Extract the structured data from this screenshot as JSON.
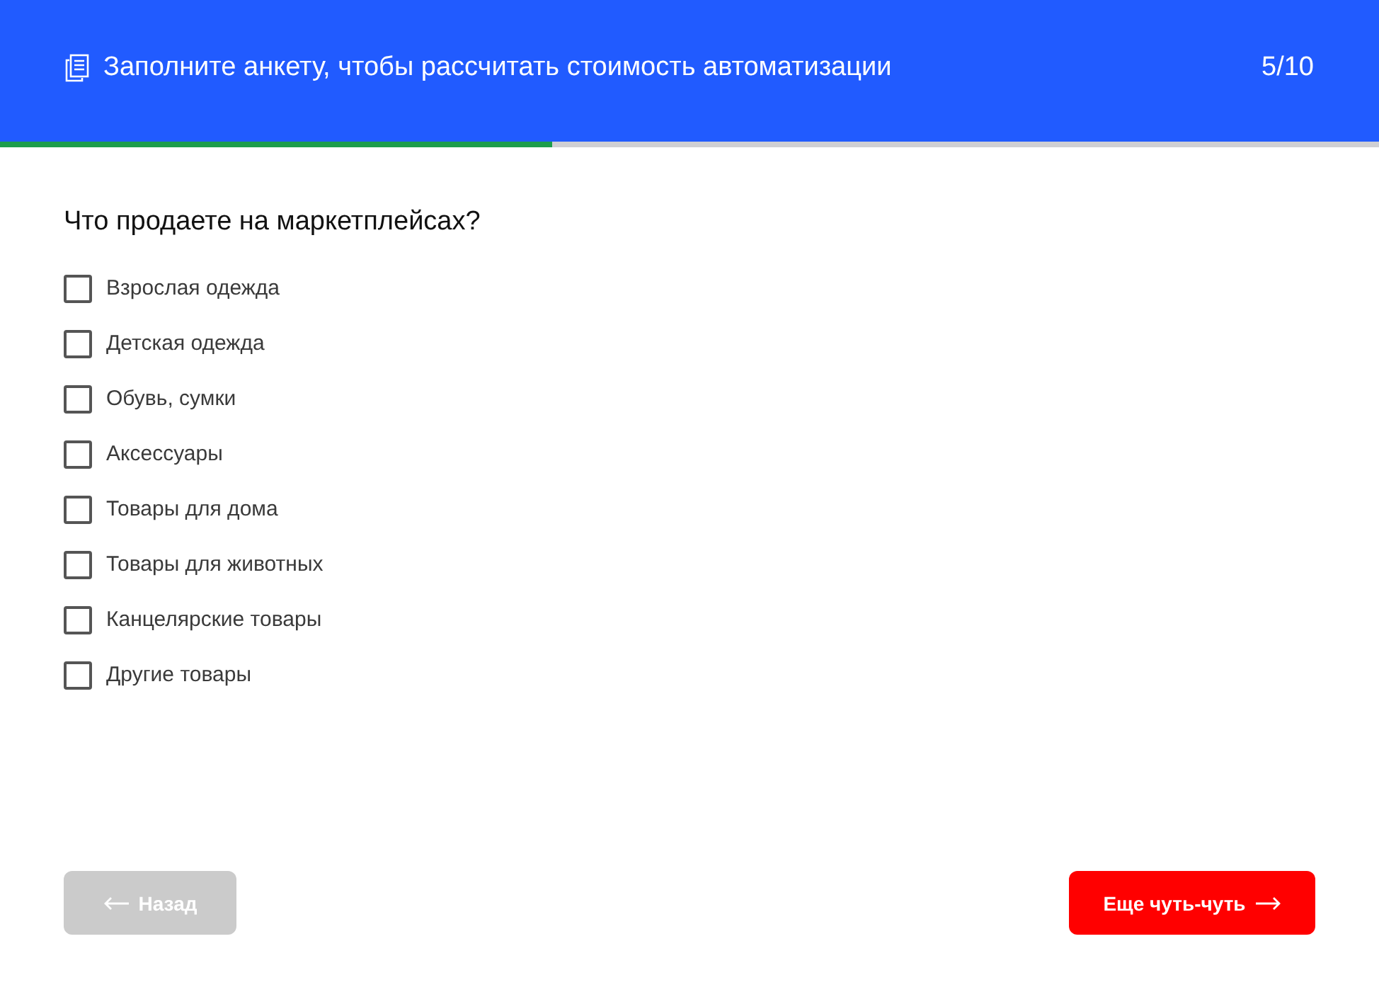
{
  "header": {
    "title": "Заполните анкету, чтобы рассчитать стоимость автоматизации",
    "counter": "5/10"
  },
  "progress": {
    "level": 0.4
  },
  "question": "Что продаете на маркетплейсах?",
  "options": [
    {
      "label": "Взрослая одежда",
      "checked": false
    },
    {
      "label": "Детская одежда",
      "checked": false
    },
    {
      "label": "Обувь, сумки",
      "checked": false
    },
    {
      "label": "Аксессуары",
      "checked": false
    },
    {
      "label": "Товары для дома",
      "checked": false
    },
    {
      "label": "Товары для животных",
      "checked": false
    },
    {
      "label": "Канцелярские товары",
      "checked": false
    },
    {
      "label": "Другие товары",
      "checked": false
    }
  ],
  "nav": [
    {
      "kind": "back",
      "label": "Назад",
      "disabled": true
    },
    {
      "kind": "next",
      "label": "Еще чуть-чуть",
      "disabled": false
    }
  ]
}
